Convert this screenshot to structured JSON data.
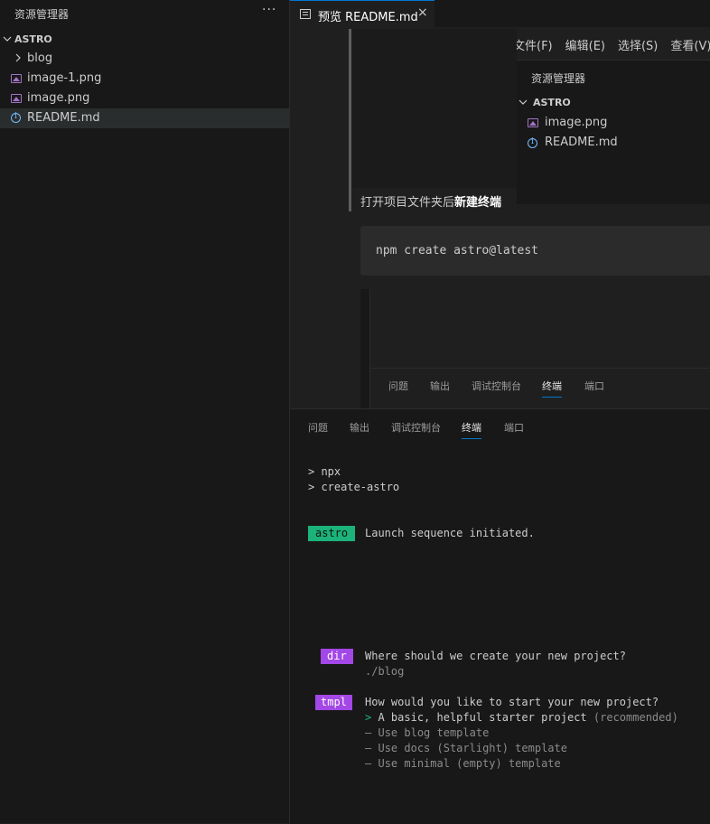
{
  "sidebar": {
    "title": "资源管理器",
    "more_label": "···",
    "root_folder": "ASTRO",
    "items": [
      {
        "label": "blog",
        "type": "folder"
      },
      {
        "label": "image-1.png",
        "type": "image"
      },
      {
        "label": "image.png",
        "type": "image"
      },
      {
        "label": "README.md",
        "type": "info",
        "selected": true
      }
    ]
  },
  "editor": {
    "tab_label": "预览 README.md",
    "tab_close": "×"
  },
  "preview": {
    "screenshot_menu": [
      "文件(F)",
      "编辑(E)",
      "选择(S)",
      "查看(V)"
    ],
    "screenshot_sidebar_title": "资源管理器",
    "screenshot_root": "ASTRO",
    "screenshot_items": [
      "image.png",
      "README.md"
    ],
    "paragraph_plain": "打开项目文件夹后",
    "paragraph_bold": "新建终端",
    "code": "npm create astro@latest",
    "screenshot_panel_tabs": [
      "问题",
      "输出",
      "调试控制台",
      "终端",
      "端口"
    ],
    "screenshot_active_tab": "终端"
  },
  "panel": {
    "tabs": [
      "问题",
      "输出",
      "调试控制台",
      "终端",
      "端口"
    ],
    "active_tab": "终端"
  },
  "terminal": {
    "line1": "> npx",
    "line2": "> create-astro",
    "astro_tag": "astro",
    "launch_text": "Launch sequence initiated.",
    "dir_tag": "dir",
    "dir_question": "Where should we create your new project?",
    "dir_answer": "./blog",
    "tmpl_tag": "tmpl",
    "tmpl_question": "How would you like to start your new project?",
    "option_selected_marker": ">",
    "option_selected": "A basic, helpful starter project",
    "option_selected_note": "(recommended)",
    "option_marker": "—",
    "options": [
      "Use blog template",
      "Use docs (Starlight) template",
      "Use minimal (empty) template"
    ]
  }
}
